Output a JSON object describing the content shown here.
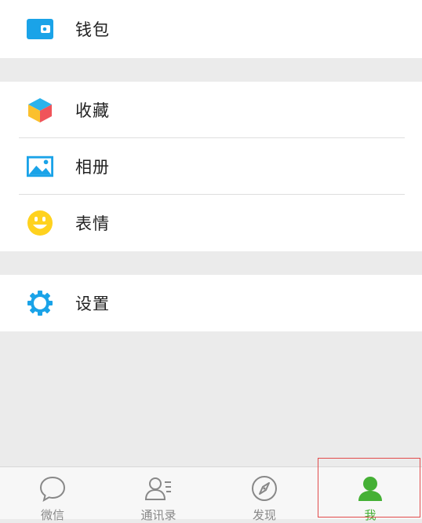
{
  "menu": {
    "wallet": {
      "label": "钱包",
      "icon": "wallet-icon"
    },
    "favorites": {
      "label": "收藏",
      "icon": "cube-icon"
    },
    "album": {
      "label": "相册",
      "icon": "picture-icon"
    },
    "stickers": {
      "label": "表情",
      "icon": "smiley-icon"
    },
    "settings": {
      "label": "设置",
      "icon": "gear-icon"
    }
  },
  "tabs": [
    {
      "label": "微信",
      "icon": "chat-bubble-icon",
      "active": false
    },
    {
      "label": "通讯录",
      "icon": "contacts-icon",
      "active": false
    },
    {
      "label": "发现",
      "icon": "compass-icon",
      "active": false
    },
    {
      "label": "我",
      "icon": "person-icon",
      "active": true
    }
  ],
  "colors": {
    "accent_green": "#45b035",
    "icon_blue": "#1aa3e8",
    "smiley_yellow": "#ffd21e",
    "highlight_red": "#e24b4b"
  }
}
